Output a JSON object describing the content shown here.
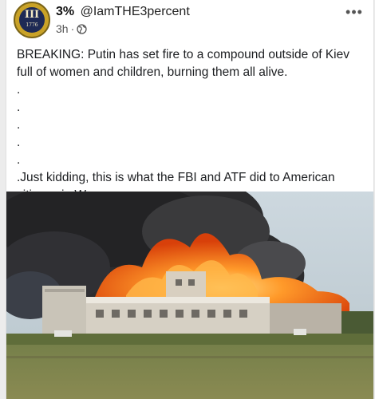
{
  "post": {
    "author_name": "3%",
    "author_handle": "@IamTHE3percent",
    "time": "3h",
    "separator": "·",
    "privacy_icon": "globe-icon",
    "more_icon": "more-options-icon",
    "avatar_emblem": "III",
    "avatar_year": "1776",
    "text_lines": [
      "BREAKING: Putin has set fire to a compound outside of Kiev full of women and children, burning them all alive.",
      ".",
      ".",
      ".",
      ".",
      ".",
      ".Just kidding, this is what the FBI and ATF did to American citizens in Waco."
    ]
  },
  "photo": {
    "kind": "photograph of a burning building complex under dark smoke",
    "colors": {
      "sky": "#c7d4dc",
      "smoke": "#2a2a2a",
      "fire": "#f06a10",
      "grass": "#6e7c3c"
    }
  }
}
